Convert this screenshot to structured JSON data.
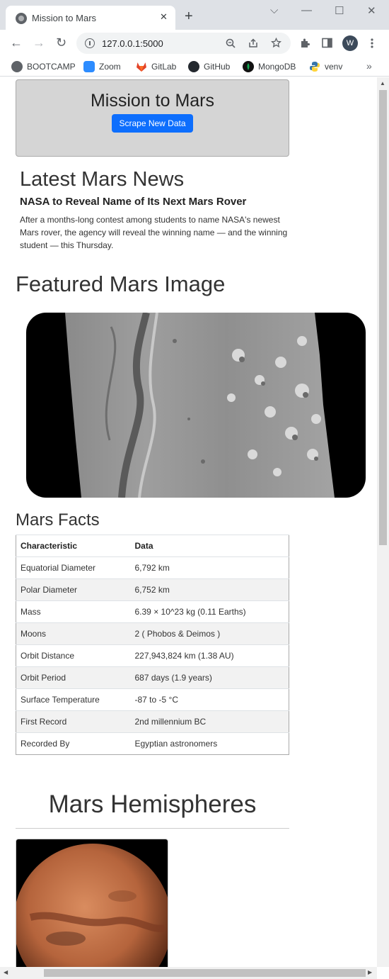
{
  "tab": {
    "title": "Mission to Mars",
    "close": "✕",
    "new_tab": "+"
  },
  "window": {
    "dropdown": "⌵",
    "minimize": "—",
    "maximize": "☐",
    "close": "✕"
  },
  "toolbar": {
    "back": "←",
    "forward": "→",
    "reload": "↻",
    "url": "127.0.0.1:5000",
    "profile_initial": "W"
  },
  "bookmarks": [
    {
      "label": "BOOTCAMP",
      "icon": "globe-icon",
      "color": "#5f6368"
    },
    {
      "label": "Zoom",
      "icon": "zoom-icon",
      "color": "#2d8cff"
    },
    {
      "label": "GitLab",
      "icon": "gitlab-icon",
      "color": "#e24329"
    },
    {
      "label": "GitHub",
      "icon": "github-icon",
      "color": "#24292f"
    },
    {
      "label": "MongoDB",
      "icon": "mongodb-icon",
      "color": "#00684a"
    },
    {
      "label": "venv",
      "icon": "python-icon",
      "color": "#3776ab"
    }
  ],
  "bookmarks_more": "»",
  "jumbotron": {
    "title": "Mission to Mars",
    "button_label": "Scrape New Data",
    "button_color": "#0d6efd"
  },
  "news": {
    "heading": "Latest Mars News",
    "title": "NASA to Reveal Name of Its Next Mars Rover",
    "paragraph": "After a months-long contest among students to name NASA's newest Mars rover, the agency will reveal the winning name — and the winning student — this Thursday."
  },
  "featured": {
    "heading": "Featured Mars Image"
  },
  "facts": {
    "heading": "Mars Facts",
    "headers": [
      "Characteristic",
      "Data"
    ],
    "rows": [
      [
        "Equatorial Diameter",
        "6,792 km"
      ],
      [
        "Polar Diameter",
        "6,752 km"
      ],
      [
        "Mass",
        "6.39 × 10^23 kg (0.11 Earths)"
      ],
      [
        "Moons",
        "2 ( Phobos & Deimos )"
      ],
      [
        "Orbit Distance",
        "227,943,824 km (1.38 AU)"
      ],
      [
        "Orbit Period",
        "687 days (1.9 years)"
      ],
      [
        "Surface Temperature",
        "-87 to -5 °C"
      ],
      [
        "First Record",
        "2nd millennium BC"
      ],
      [
        "Recorded By",
        "Egyptian astronomers"
      ]
    ]
  },
  "hemispheres": {
    "heading": "Mars Hemispheres"
  }
}
